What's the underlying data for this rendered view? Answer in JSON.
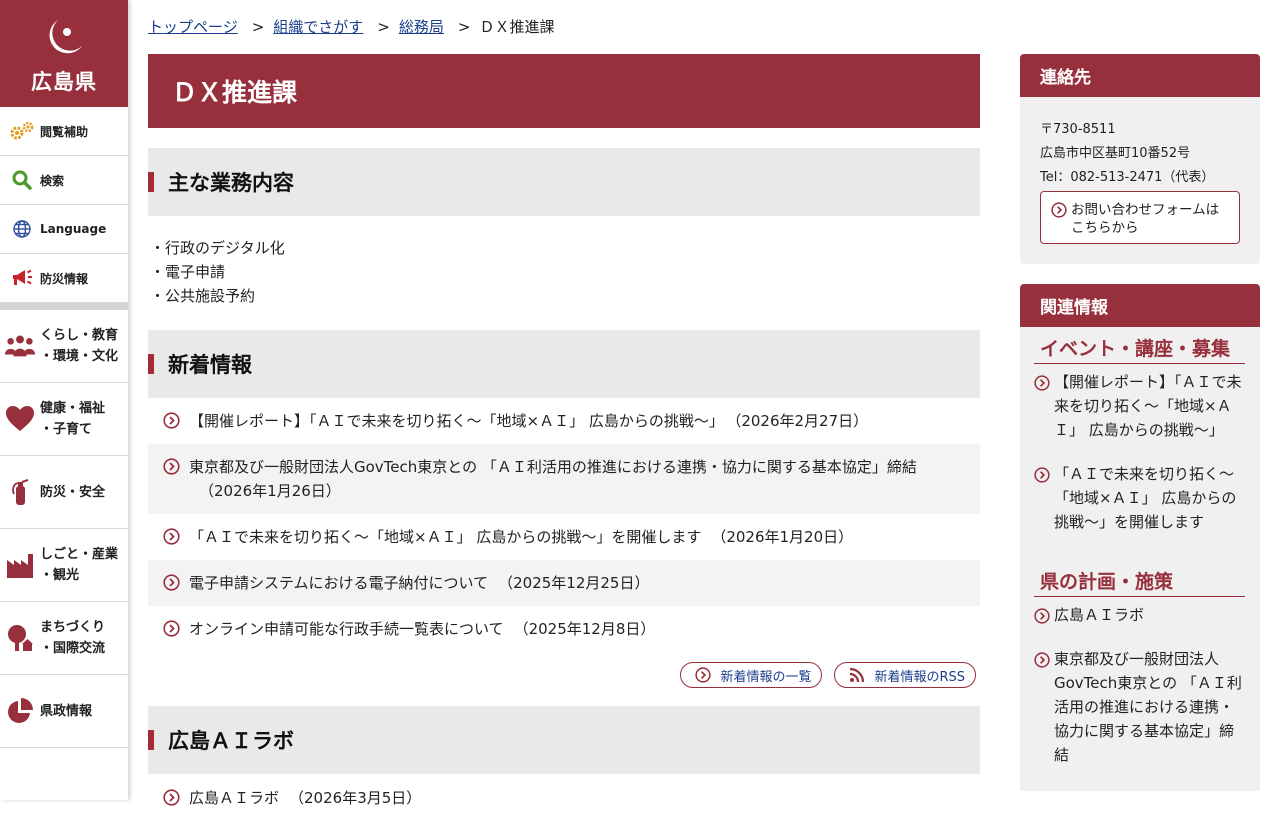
{
  "colors": {
    "brand": "#97303c",
    "link": "#1a3e8c",
    "section_bg": "#e9e9e9"
  },
  "logo": {
    "text": "広島県"
  },
  "sidebar": {
    "utilities": [
      {
        "label": "閲覧補助",
        "icon": "gears-icon"
      },
      {
        "label": "検索",
        "icon": "search-icon"
      },
      {
        "label": "Language",
        "icon": "globe-icon"
      },
      {
        "label": "防災情報",
        "icon": "megaphone-icon"
      }
    ],
    "categories": [
      {
        "label": "くらし・教育\n・環境・文化",
        "icon": "people-icon"
      },
      {
        "label": "健康・福祉\n・子育て",
        "icon": "heart-icon"
      },
      {
        "label": "防災・安全",
        "icon": "fire-extinguisher-icon"
      },
      {
        "label": "しごと・産業\n・観光",
        "icon": "factory-icon"
      },
      {
        "label": "まちづくり\n・国際交流",
        "icon": "tree-icon"
      },
      {
        "label": "県政情報",
        "icon": "pie-chart-icon"
      }
    ]
  },
  "breadcrumb": {
    "items": [
      "トップページ",
      "組織でさがす",
      "総務局"
    ],
    "current": "ＤＸ推進課",
    "separator": ">"
  },
  "main": {
    "title": "ＤＸ推進課",
    "duties": {
      "heading": "主な業務内容",
      "items": [
        "・行政のデジタル化",
        "・電子申請",
        "・公共施設予約"
      ]
    },
    "news": {
      "heading": "新着情報",
      "items": [
        {
          "text": "【開催レポート】「ＡＩで未来を切り拓く～「地域×ＡＩ」 広島からの挑戦～」",
          "date": "（2026年2月27日）"
        },
        {
          "text": "東京都及び一般財団法人GovTech東京との 「ＡＩ利活用の推進における連携・協力に関する基本協定」締結",
          "date": "（2026年1月26日）"
        },
        {
          "text": "「ＡＩで未来を切り拓く～「地域×ＡＩ」 広島からの挑戦～」を開催します",
          "date": "（2026年1月20日）"
        },
        {
          "text": "電子申請システムにおける電子納付について",
          "date": "（2025年12月25日）"
        },
        {
          "text": "オンライン申請可能な行政手続一覧表について",
          "date": "（2025年12月8日）"
        }
      ],
      "list_button": "新着情報の一覧",
      "rss_button": "新着情報のRSS"
    },
    "ailab": {
      "heading": "広島ＡＩラボ",
      "items": [
        {
          "text": "広島ＡＩラボ",
          "date": "（2026年3月5日）"
        }
      ]
    }
  },
  "contact": {
    "heading": "連絡先",
    "postal": "〒730-8511",
    "address": "広島市中区基町10番52号",
    "tel": "Tel：082-513-2471（代表）",
    "form_button": "お問い合わせフォームはこちらから"
  },
  "related": {
    "heading": "関連情報",
    "groups": [
      {
        "title": "イベント・講座・募集",
        "items": [
          "【開催レポート】「ＡＩで未来を切り拓く～「地域×ＡＩ」 広島からの挑戦～」",
          "「ＡＩで未来を切り拓く～「地域×ＡＩ」 広島からの挑戦～」を開催します"
        ]
      },
      {
        "title": "県の計画・施策",
        "items": [
          "広島ＡＩラボ",
          "東京都及び一般財団法人GovTech東京との 「ＡＩ利活用の推進における連携・協力に関する基本協定」締結"
        ]
      }
    ]
  }
}
